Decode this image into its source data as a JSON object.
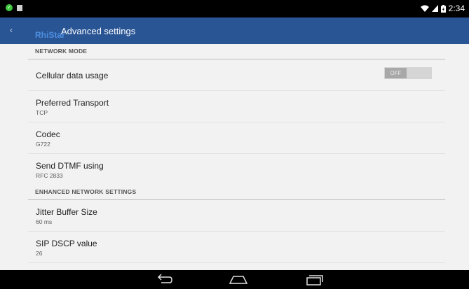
{
  "status_bar": {
    "time": "2:34",
    "icons": [
      "notification-check-icon",
      "notification-square-icon",
      "wifi-icon",
      "signal-icon",
      "battery-icon"
    ]
  },
  "action_bar": {
    "logo_part1": "RhiStar",
    "logo_part2": "",
    "title": "Advanced settings"
  },
  "sections": [
    {
      "header": "NETWORK MODE",
      "items": [
        {
          "title": "Cellular data usage",
          "summary": "",
          "toggle": "OFF"
        },
        {
          "title": "Preferred Transport",
          "summary": "TCP"
        },
        {
          "title": "Codec",
          "summary": "G722"
        },
        {
          "title": "Send DTMF using",
          "summary": "RFC 2833"
        }
      ]
    },
    {
      "header": "ENHANCED NETWORK SETTINGS",
      "items": [
        {
          "title": "Jitter Buffer Size",
          "summary": "60 ms"
        },
        {
          "title": "SIP DSCP value",
          "summary": "26"
        }
      ]
    }
  ],
  "colors": {
    "action_bar": "#2a5595",
    "background": "#f2f2f2",
    "logo_accent": "#4c8fe0"
  }
}
